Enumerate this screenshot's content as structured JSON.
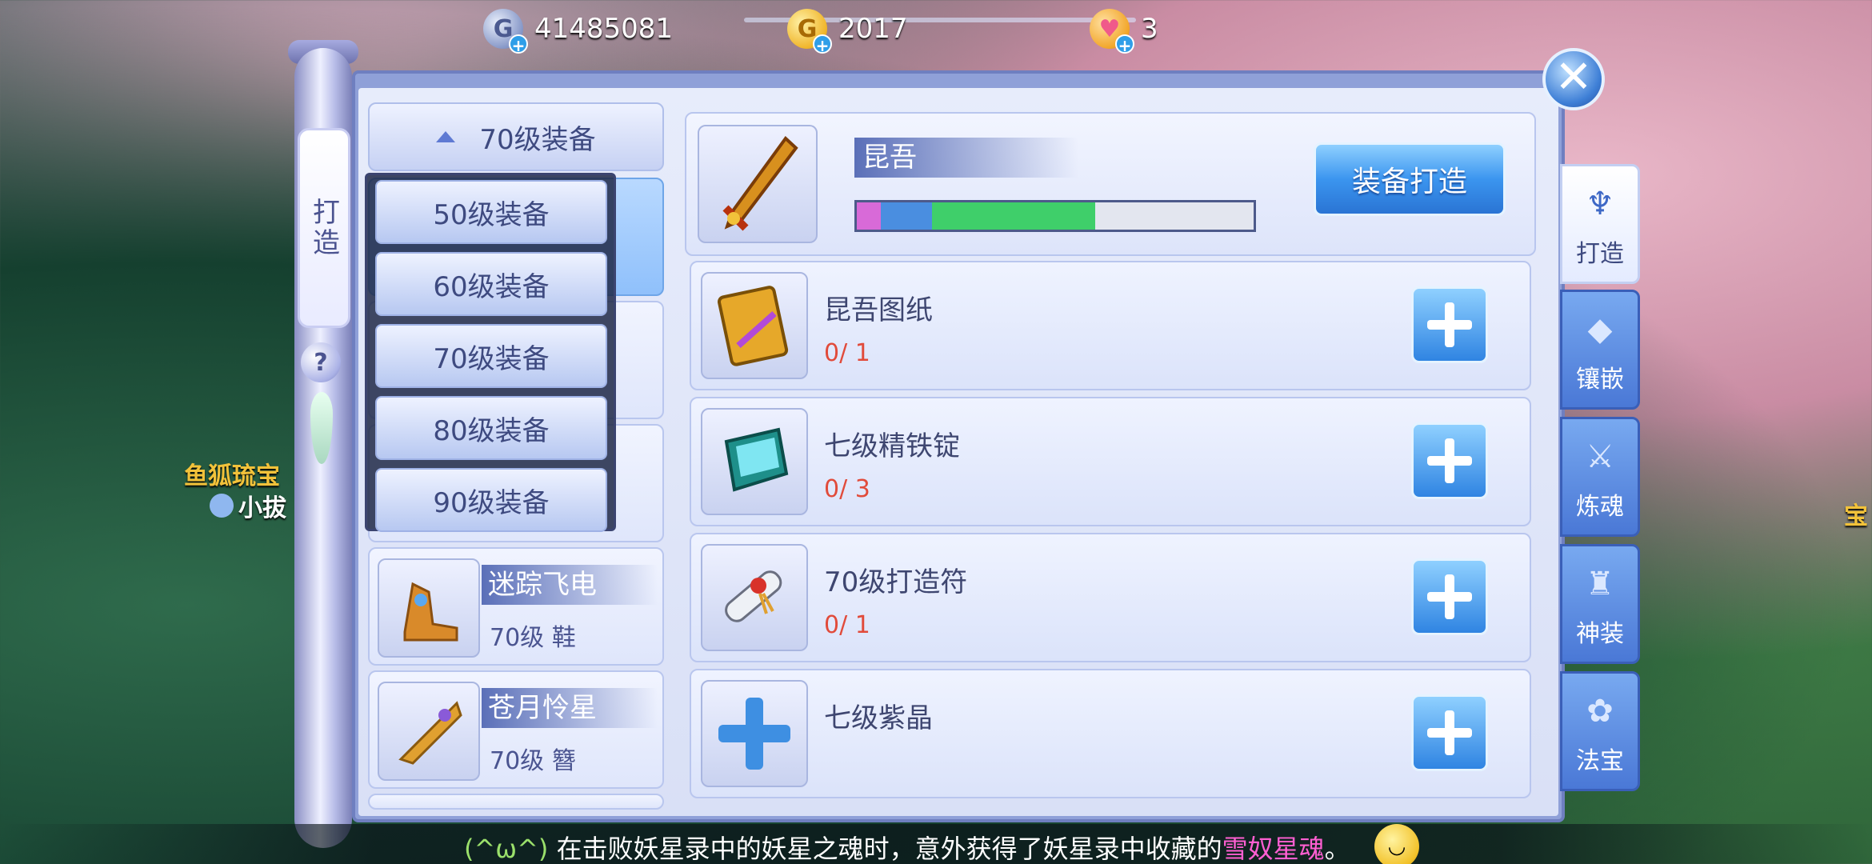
{
  "currencies": [
    {
      "icon": "silver-coin-icon",
      "value": "41485081"
    },
    {
      "icon": "gold-coin-icon",
      "value": "2017"
    },
    {
      "icon": "heart-icon",
      "value": "3"
    }
  ],
  "scroll_tab": {
    "label": "打造"
  },
  "level_select": {
    "label": "70级装备"
  },
  "dropdown_options": [
    "50级装备",
    "60级装备",
    "70级装备",
    "80级装备",
    "90级装备"
  ],
  "equipment_list": [
    {
      "name": "迷踪飞电",
      "sub": "70级 鞋"
    },
    {
      "name": "苍月怜星",
      "sub": "70级 簪"
    }
  ],
  "detail": {
    "name": "昆吾",
    "craft_button": "装备打造",
    "bar_segments": [
      {
        "color": "#d86ad8",
        "fraction": 0.06
      },
      {
        "color": "#4a8ee0",
        "fraction": 0.13
      },
      {
        "color": "#3fcf6a",
        "fraction": 0.41
      },
      {
        "color": "#e3e6ef",
        "fraction": 0.4
      }
    ]
  },
  "materials": [
    {
      "name": "昆吾图纸",
      "count": "0/ 1",
      "icon": "blueprint-book-icon"
    },
    {
      "name": "七级精铁锭",
      "count": "0/ 3",
      "icon": "iron-ingot-icon"
    },
    {
      "name": "70级打造符",
      "count": "0/ 1",
      "icon": "scroll-charm-icon"
    },
    {
      "name": "七级紫晶",
      "count": "",
      "icon": "add-slot-icon"
    }
  ],
  "side_tabs": [
    {
      "label": "打造",
      "icon": "forge-icon",
      "active": true
    },
    {
      "label": "镶嵌",
      "icon": "diamond-icon",
      "active": false
    },
    {
      "label": "炼魂",
      "icon": "soul-icon",
      "active": false
    },
    {
      "label": "神装",
      "icon": "divine-armor-icon",
      "active": false
    },
    {
      "label": "法宝",
      "icon": "treasure-icon",
      "active": false
    }
  ],
  "ticker": {
    "emoticon": "(^ω^)",
    "message": "在击败妖星录中的妖星之魂时，意外获得了妖星录中收藏的",
    "highlight": "雪奴星魂",
    "end": "。"
  },
  "background_labels": {
    "npc_name": "鱼狐琉宝",
    "npc_sub": "小拔",
    "right_label": "宝"
  }
}
